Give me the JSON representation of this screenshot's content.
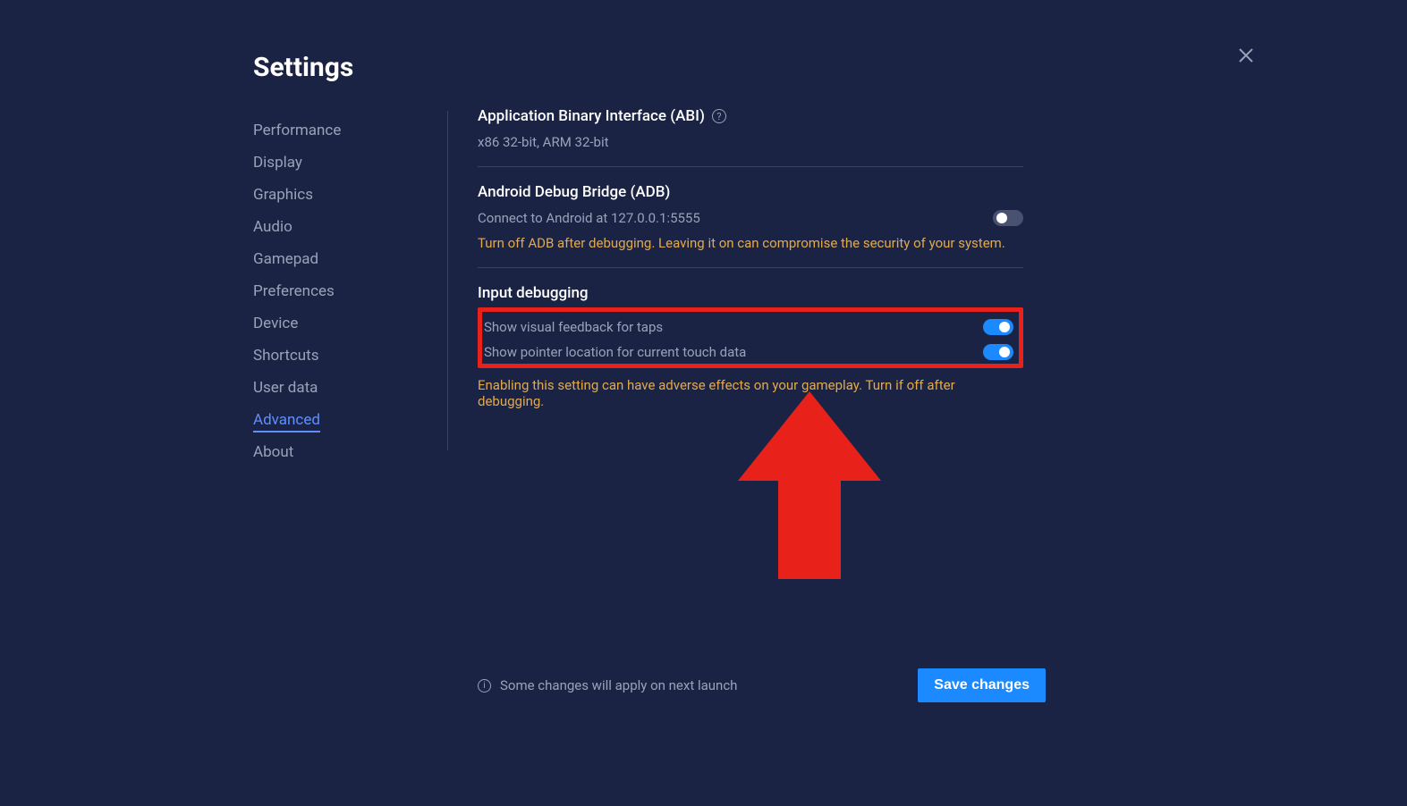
{
  "title": "Settings",
  "sidebar": {
    "items": [
      {
        "label": "Performance"
      },
      {
        "label": "Display"
      },
      {
        "label": "Graphics"
      },
      {
        "label": "Audio"
      },
      {
        "label": "Gamepad"
      },
      {
        "label": "Preferences"
      },
      {
        "label": "Device"
      },
      {
        "label": "Shortcuts"
      },
      {
        "label": "User data"
      },
      {
        "label": "Advanced"
      },
      {
        "label": "About"
      }
    ],
    "active_index": 9
  },
  "sections": {
    "abi": {
      "title": "Application Binary Interface (ABI)",
      "value": "x86 32-bit, ARM 32-bit"
    },
    "adb": {
      "title": "Android Debug Bridge (ADB)",
      "sub": "Connect to Android at 127.0.0.1:5555",
      "toggle_on": false,
      "warning": "Turn off ADB after debugging. Leaving it on can compromise the security of your system."
    },
    "input_debug": {
      "title": "Input debugging",
      "opt1_label": "Show visual feedback for taps",
      "opt1_on": true,
      "opt2_label": "Show pointer location for current touch data",
      "opt2_on": true,
      "warning": "Enabling this setting can have adverse effects on your gameplay. Turn if off after debugging."
    }
  },
  "footer": {
    "note": "Some changes will apply on next launch",
    "save_label": "Save changes"
  }
}
